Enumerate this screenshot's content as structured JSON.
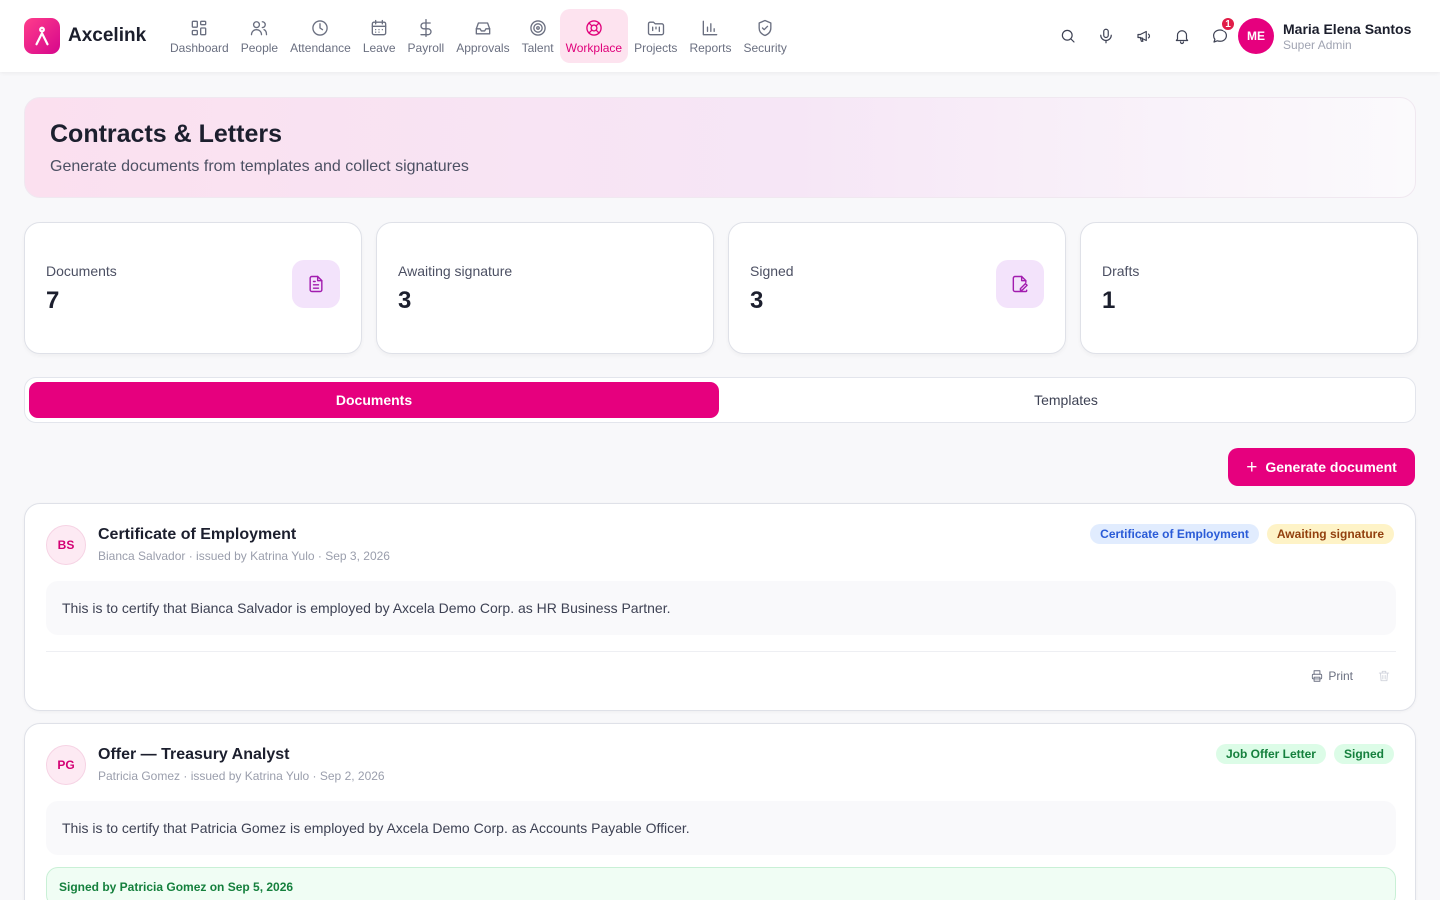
{
  "app": {
    "name": "Axcelink",
    "brand_color": "#e6007e"
  },
  "nav": [
    {
      "label": "Dashboard",
      "icon": "dashboard-icon"
    },
    {
      "label": "People",
      "icon": "people-icon"
    },
    {
      "label": "Attendance",
      "icon": "clock-icon"
    },
    {
      "label": "Leave",
      "icon": "calendar-icon"
    },
    {
      "label": "Payroll",
      "icon": "dollar-icon"
    },
    {
      "label": "Approvals",
      "icon": "inbox-icon"
    },
    {
      "label": "Talent",
      "icon": "target-icon"
    },
    {
      "label": "Workplace",
      "icon": "lifebuoy-icon",
      "active": true
    },
    {
      "label": "Projects",
      "icon": "folder-kanban-icon"
    },
    {
      "label": "Reports",
      "icon": "bar-chart-icon"
    },
    {
      "label": "Security",
      "icon": "shield-icon"
    }
  ],
  "header": {
    "notification_count": "1",
    "user": {
      "initials": "ME",
      "name": "Maria Elena Santos",
      "role": "Super Admin"
    }
  },
  "page": {
    "title": "Contracts & Letters",
    "subtitle": "Generate documents from templates and collect signatures"
  },
  "stats": [
    {
      "label": "Documents",
      "value": "7",
      "icon": "file-text-icon"
    },
    {
      "label": "Awaiting signature",
      "value": "3"
    },
    {
      "label": "Signed",
      "value": "3",
      "icon": "file-signature-icon"
    },
    {
      "label": "Drafts",
      "value": "1"
    }
  ],
  "tabs": {
    "documents": "Documents",
    "templates": "Templates",
    "active": "Documents"
  },
  "actions": {
    "generate": "Generate document",
    "print": "Print"
  },
  "documents": [
    {
      "initials": "BS",
      "title": "Certificate of Employment",
      "meta": "Bianca Salvador · issued by Katrina Yulo · Sep 3, 2026",
      "type": "Certificate of Employment",
      "status": "Awaiting signature",
      "body": "This is to certify that Bianca Salvador is employed by Axcela Demo Corp. as HR Business Partner."
    },
    {
      "initials": "PG",
      "title": "Offer — Treasury Analyst",
      "meta": "Patricia Gomez · issued by Katrina Yulo · Sep 2, 2026",
      "type": "Job Offer Letter",
      "status": "Signed",
      "body": "This is to certify that Patricia Gomez is employed by Axcela Demo Corp. as Accounts Payable Officer.",
      "signed_note": "Signed by Patricia Gomez on Sep 5, 2026"
    }
  ]
}
